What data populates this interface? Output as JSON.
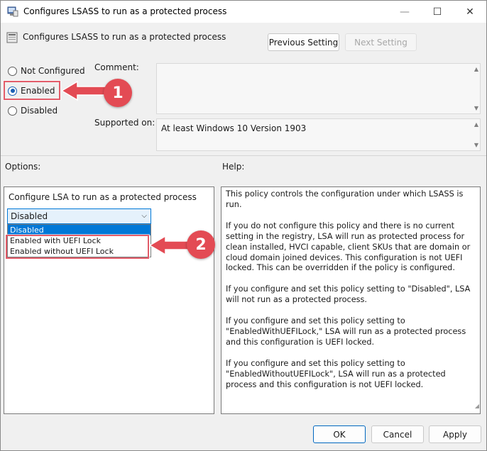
{
  "window": {
    "title": "Configures LSASS to run as a protected process",
    "controls": {
      "minimize": "—",
      "maximize": "☐",
      "close": "✕"
    }
  },
  "header": {
    "policy_title": "Configures LSASS to run as a protected process",
    "previous_label": "Previous Setting",
    "next_label": "Next Setting"
  },
  "state_options": [
    {
      "label": "Not Configured",
      "checked": false
    },
    {
      "label": "Enabled",
      "checked": true
    },
    {
      "label": "Disabled",
      "checked": false
    }
  ],
  "comment": {
    "label": "Comment:",
    "value": ""
  },
  "supported": {
    "label": "Supported on:",
    "value": "At least Windows 10 Version 1903"
  },
  "options": {
    "section_label": "Options:",
    "setting_label": "Configure LSA to run as a protected process",
    "selected": "Disabled",
    "items": [
      "Disabled",
      "Enabled with UEFI Lock",
      "Enabled without UEFI Lock"
    ]
  },
  "help": {
    "section_label": "Help:",
    "paragraphs": [
      "This policy controls the configuration under which LSASS is run.",
      "If you do not configure this policy and there is no current setting in the registry, LSA will run as protected process for clean installed, HVCI capable, client SKUs that are domain or cloud domain joined devices. This configuration is not UEFI locked. This can be overridden if the policy is configured.",
      "If you configure and set this policy setting to \"Disabled\", LSA will not run as a protected process.",
      "If you configure and set this policy setting to \"EnabledWithUEFILock,\" LSA will run as a protected process and this configuration is UEFI locked.",
      "If you configure and set this policy setting to \"EnabledWithoutUEFILock\", LSA will run as a protected process and this configuration is not UEFI locked."
    ]
  },
  "callouts": [
    {
      "number": "1"
    },
    {
      "number": "2"
    }
  ],
  "footer": {
    "ok_label": "OK",
    "cancel_label": "Cancel",
    "apply_label": "Apply"
  },
  "colors": {
    "accent": "#0078d7",
    "callout": "#e34b54",
    "highlight": "#e35d6a"
  }
}
